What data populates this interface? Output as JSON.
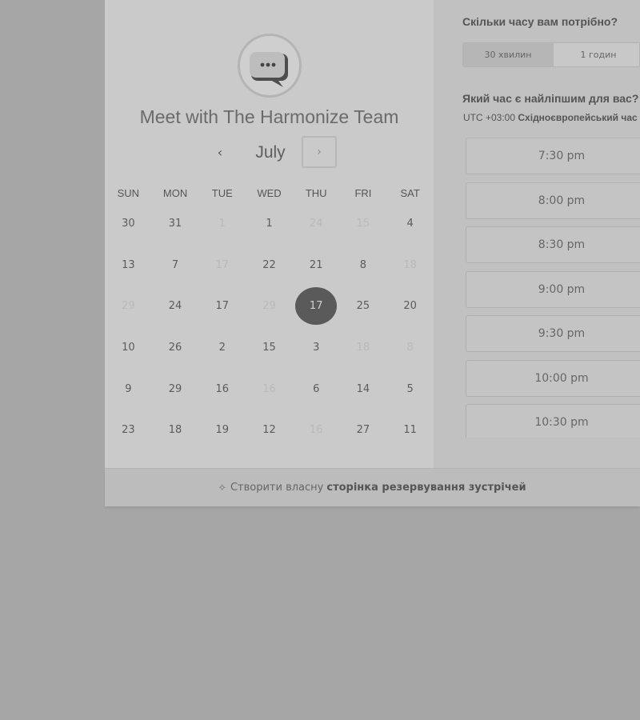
{
  "header": {
    "title": "Meet with The Harmonize Team"
  },
  "calendar": {
    "month": "July",
    "prev_label": "‹",
    "next_label": "›",
    "weekdays": [
      "SUN",
      "MON",
      "TUE",
      "WED",
      "THU",
      "FRI",
      "SAT"
    ],
    "days": [
      {
        "label": "30",
        "disabled": false
      },
      {
        "label": "31",
        "disabled": false
      },
      {
        "label": "1",
        "disabled": true
      },
      {
        "label": "1",
        "disabled": false
      },
      {
        "label": "24",
        "disabled": true
      },
      {
        "label": "15",
        "disabled": true
      },
      {
        "label": "4",
        "disabled": false
      },
      {
        "label": "13",
        "disabled": false
      },
      {
        "label": "7",
        "disabled": false
      },
      {
        "label": "17",
        "disabled": true
      },
      {
        "label": "22",
        "disabled": false
      },
      {
        "label": "21",
        "disabled": false
      },
      {
        "label": "8",
        "disabled": false
      },
      {
        "label": "18",
        "disabled": true
      },
      {
        "label": "29",
        "disabled": true
      },
      {
        "label": "24",
        "disabled": false
      },
      {
        "label": "17",
        "disabled": false
      },
      {
        "label": "29",
        "disabled": true
      },
      {
        "label": "17",
        "disabled": false,
        "selected": true
      },
      {
        "label": "25",
        "disabled": false
      },
      {
        "label": "20",
        "disabled": false
      },
      {
        "label": "10",
        "disabled": false
      },
      {
        "label": "26",
        "disabled": false
      },
      {
        "label": "2",
        "disabled": false
      },
      {
        "label": "15",
        "disabled": false
      },
      {
        "label": "3",
        "disabled": false
      },
      {
        "label": "18",
        "disabled": true
      },
      {
        "label": "8",
        "disabled": true
      },
      {
        "label": "9",
        "disabled": false
      },
      {
        "label": "29",
        "disabled": false
      },
      {
        "label": "16",
        "disabled": false
      },
      {
        "label": "16",
        "disabled": true
      },
      {
        "label": "6",
        "disabled": false
      },
      {
        "label": "14",
        "disabled": false
      },
      {
        "label": "5",
        "disabled": false
      },
      {
        "label": "23",
        "disabled": false
      },
      {
        "label": "18",
        "disabled": false
      },
      {
        "label": "19",
        "disabled": false
      },
      {
        "label": "12",
        "disabled": false
      },
      {
        "label": "16",
        "disabled": true
      },
      {
        "label": "27",
        "disabled": false
      },
      {
        "label": "11",
        "disabled": false
      }
    ]
  },
  "booking": {
    "duration_question": "Скільки часу вам потрібно?",
    "durations": [
      {
        "label": "30 хвилин",
        "active": true
      },
      {
        "label": "1 годин",
        "active": false
      }
    ],
    "time_question": "Який час є найліпшим для вас?",
    "timezone_offset": "UTC +03:00",
    "timezone_name": "Східноєвропейський час",
    "slots": [
      "7:30 pm",
      "8:00 pm",
      "8:30 pm",
      "9:00 pm",
      "9:30 pm",
      "10:00 pm",
      "10:30 pm"
    ]
  },
  "footer": {
    "prefix": "Створити власну",
    "link": "сторінка резервування зустрічей"
  }
}
